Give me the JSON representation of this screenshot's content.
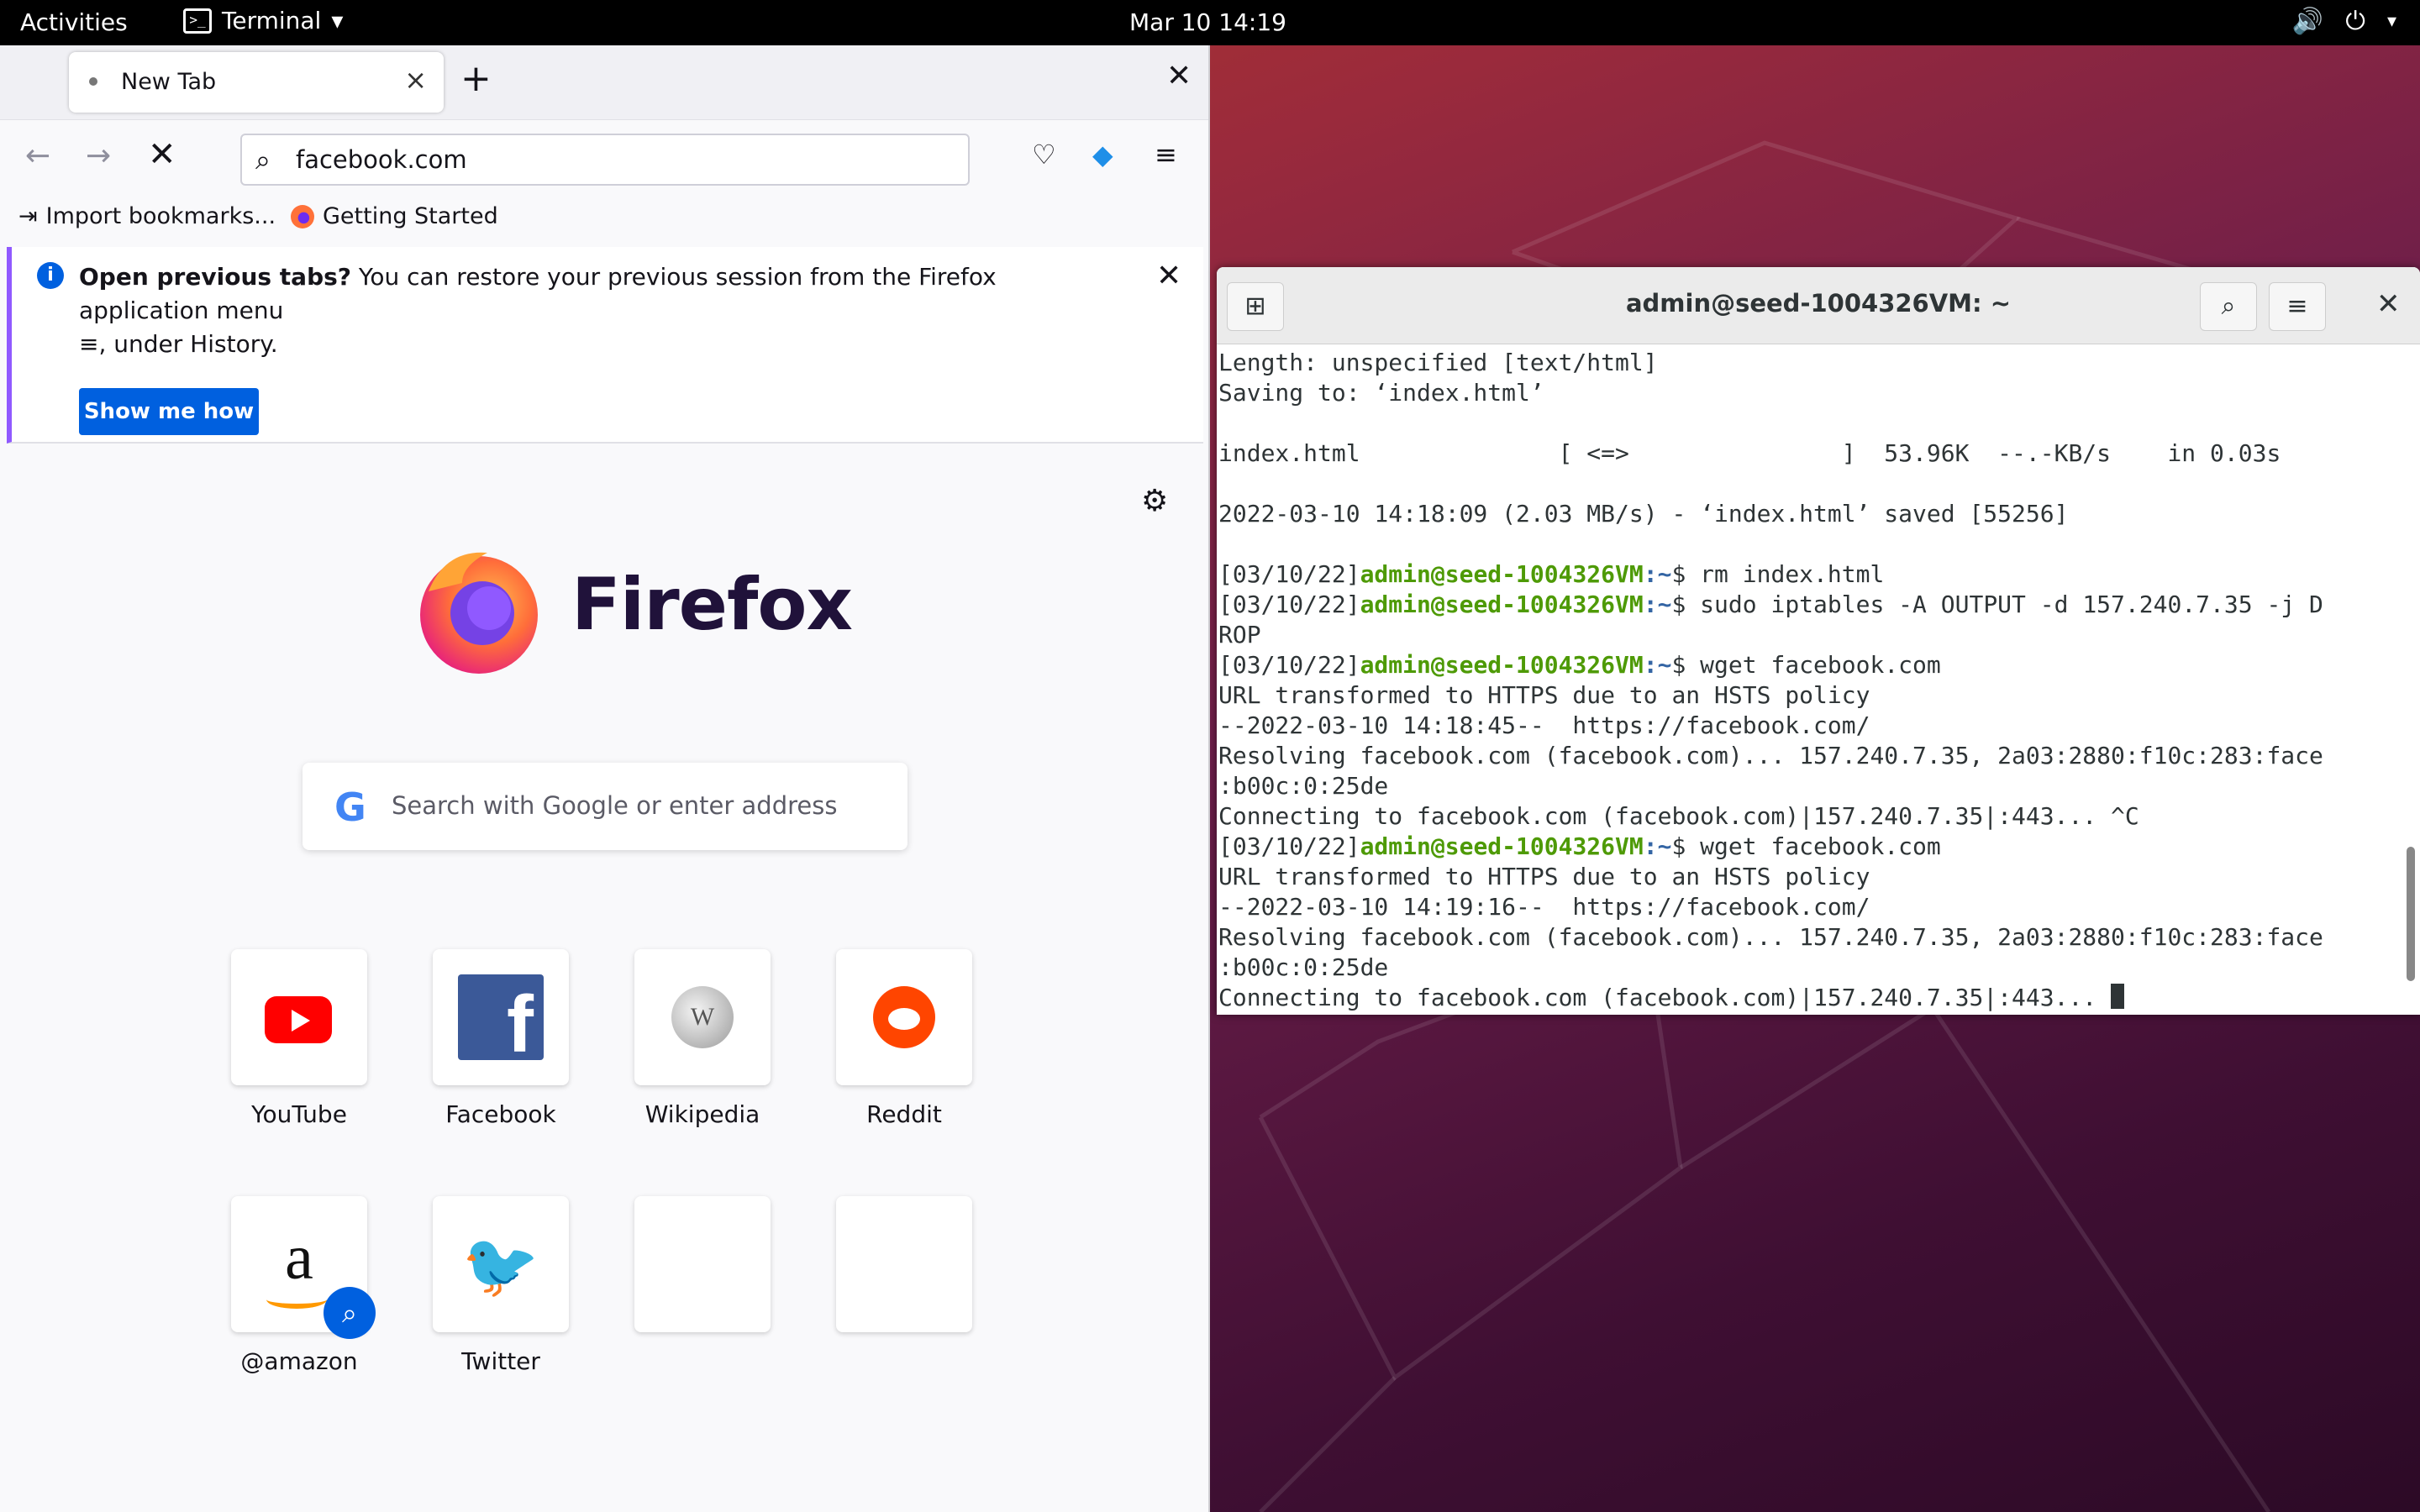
{
  "topbar": {
    "activities": "Activities",
    "app_name": "Terminal",
    "clock": "Mar 10  14:19"
  },
  "firefox": {
    "tab": {
      "label": "New Tab"
    },
    "url": "facebook.com",
    "bookmarks": [
      "Import bookmarks...",
      "Getting Started"
    ],
    "notice": {
      "bold": "Open previous tabs?",
      "text": " You can restore your previous session from the Firefox application menu ",
      "text2": ", under History.",
      "button": "Show me how"
    },
    "brand": "Firefox",
    "search_placeholder": "Search with Google or enter address",
    "tiles": [
      {
        "label": "YouTube",
        "icon": "youtube-icon"
      },
      {
        "label": "Facebook",
        "icon": "facebook-icon"
      },
      {
        "label": "Wikipedia",
        "icon": "wikipedia-icon"
      },
      {
        "label": "Reddit",
        "icon": "reddit-icon"
      },
      {
        "label": "@amazon",
        "icon": "amazon-icon"
      },
      {
        "label": "Twitter",
        "icon": "twitter-icon"
      },
      {
        "label": "",
        "icon": ""
      },
      {
        "label": "",
        "icon": ""
      }
    ]
  },
  "terminal": {
    "title": "admin@seed-1004326VM: ~",
    "prompt_date": "[03/10/22]",
    "prompt_user": "admin@seed-1004326VM",
    "prompt_path": ":~",
    "prompt_sym": "$ ",
    "lines": [
      {
        "t": "Length: unspecified [text/html]"
      },
      {
        "t": "Saving to: ‘index.html’"
      },
      {
        "t": ""
      },
      {
        "t": "index.html              [ <=>               ]  53.96K  --.-KB/s    in 0.03s"
      },
      {
        "t": ""
      },
      {
        "t": "2022-03-10 14:18:09 (2.03 MB/s) - ‘index.html’ saved [55256]"
      },
      {
        "t": ""
      },
      {
        "cmd": "rm index.html"
      },
      {
        "cmd": "sudo iptables -A OUTPUT -d 157.240.7.35 -j D"
      },
      {
        "t": "ROP"
      },
      {
        "cmd": "wget facebook.com"
      },
      {
        "t": "URL transformed to HTTPS due to an HSTS policy"
      },
      {
        "t": "--2022-03-10 14:18:45--  https://facebook.com/"
      },
      {
        "t": "Resolving facebook.com (facebook.com)... 157.240.7.35, 2a03:2880:f10c:283:face"
      },
      {
        "t": ":b00c:0:25de"
      },
      {
        "t": "Connecting to facebook.com (facebook.com)|157.240.7.35|:443... ^C"
      },
      {
        "cmd": "wget facebook.com"
      },
      {
        "t": "URL transformed to HTTPS due to an HSTS policy"
      },
      {
        "t": "--2022-03-10 14:19:16--  https://facebook.com/"
      },
      {
        "t": "Resolving facebook.com (facebook.com)... 157.240.7.35, 2a03:2880:f10c:283:face"
      },
      {
        "t": ":b00c:0:25de"
      },
      {
        "t": "Connecting to facebook.com (facebook.com)|157.240.7.35|:443... ",
        "cursor": true
      }
    ]
  },
  "colors": {
    "firefox_accent": "#0060df",
    "prompt_user": "#4e9a06",
    "prompt_path": "#3465a4"
  }
}
